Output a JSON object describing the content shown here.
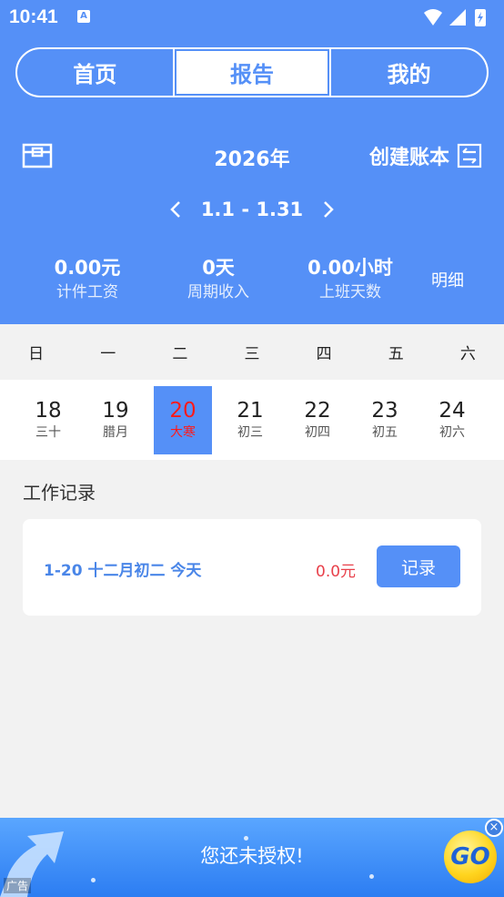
{
  "status_bar": {
    "time": "10:41",
    "notification_icon": "A"
  },
  "tabs": [
    {
      "label": "首页",
      "active": false
    },
    {
      "label": "报告",
      "active": true
    },
    {
      "label": "我的",
      "active": false
    }
  ],
  "header": {
    "year": "2026年",
    "create_ledger": "创建账本",
    "date_range": "1.1 - 1.31",
    "detail_link": "明细"
  },
  "stats": [
    {
      "value": "0.00元",
      "label": "计件工资"
    },
    {
      "value": "0天",
      "label": "周期收入"
    },
    {
      "value": "0.00小时",
      "label": "上班天数"
    }
  ],
  "weekdays": [
    "日",
    "一",
    "二",
    "三",
    "四",
    "五",
    "六"
  ],
  "days": [
    {
      "num": "18",
      "lunar": "三十"
    },
    {
      "num": "19",
      "lunar": "腊月"
    },
    {
      "num": "20",
      "lunar": "大寒",
      "selected": true
    },
    {
      "num": "21",
      "lunar": "初三"
    },
    {
      "num": "22",
      "lunar": "初四"
    },
    {
      "num": "23",
      "lunar": "初五"
    },
    {
      "num": "24",
      "lunar": "初六"
    }
  ],
  "work_records": {
    "title": "工作记录",
    "items": [
      {
        "date": "1-20 十二月初二 今天",
        "amount": "0.0元",
        "button": "记录"
      }
    ]
  },
  "ad": {
    "text": "您还未授权!",
    "label": "广告",
    "go": "GO",
    "close": "×"
  },
  "colors": {
    "primary": "#5590f7",
    "accent_red": "#e8404a",
    "link_blue": "#4a86e8"
  }
}
